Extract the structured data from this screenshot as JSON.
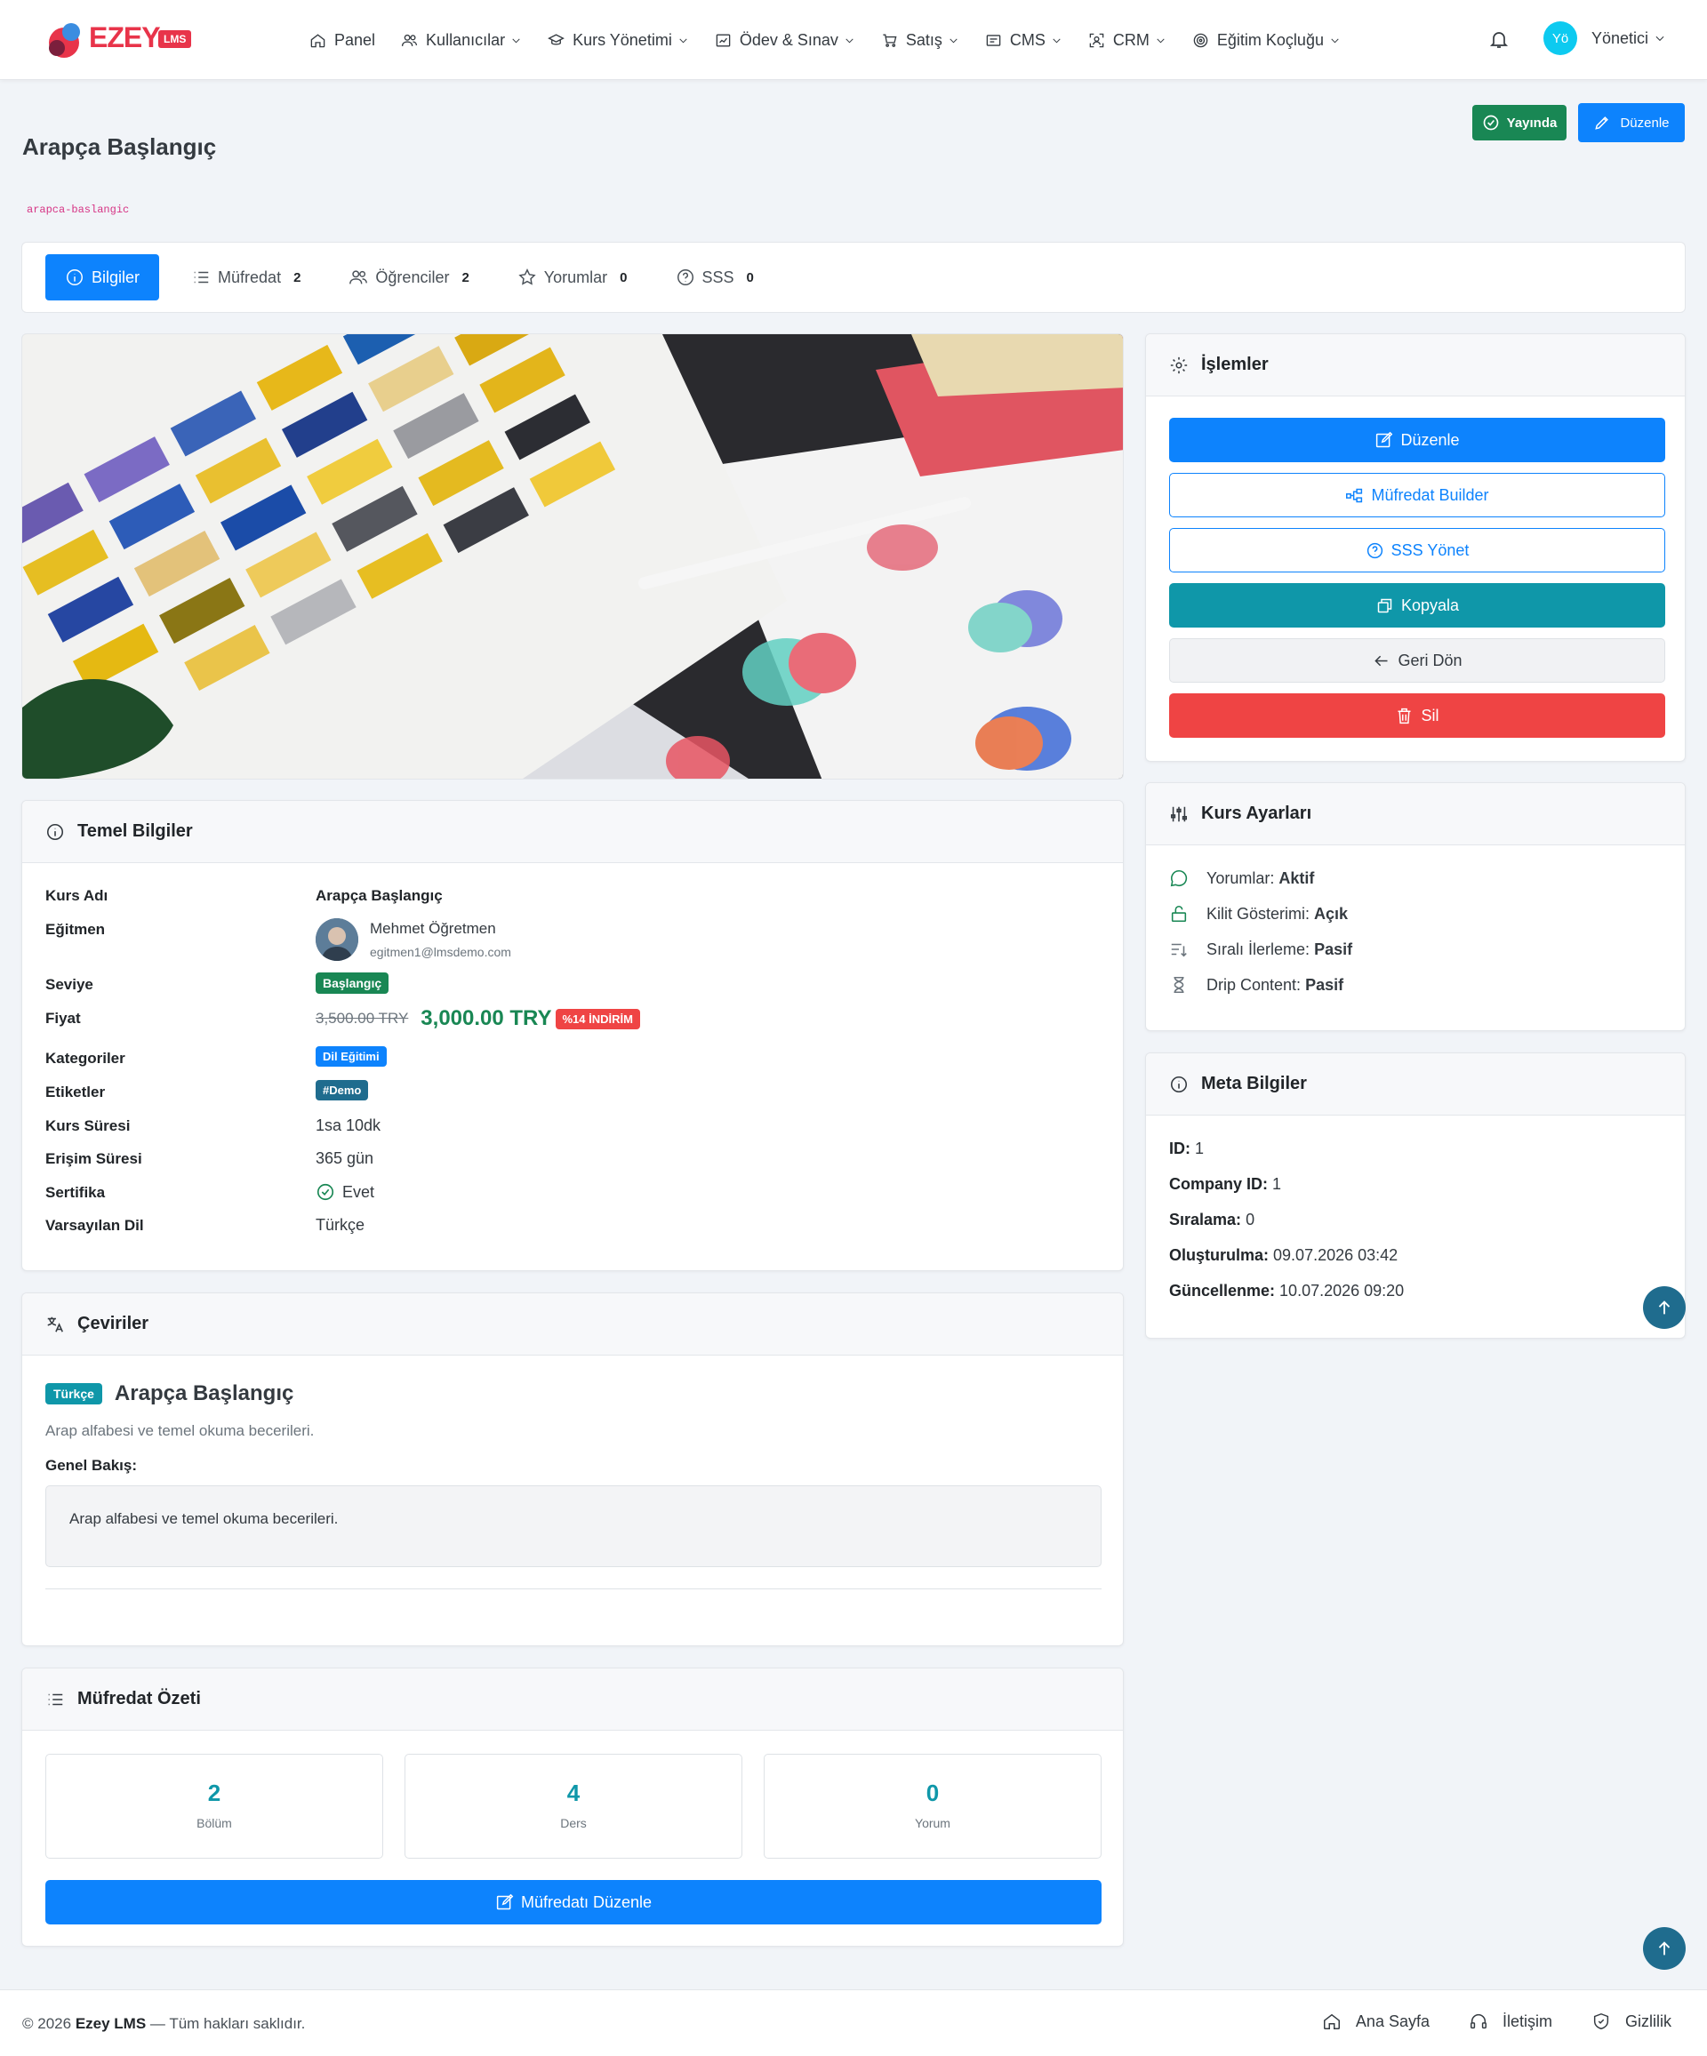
{
  "brand": {
    "name": "EZEY",
    "badge": "LMS"
  },
  "nav": {
    "items": [
      {
        "label": "Panel",
        "icon": "home-icon"
      },
      {
        "label": "Kullanıcılar",
        "icon": "users-icon"
      },
      {
        "label": "Kurs Yönetimi",
        "icon": "graduation-cap-icon"
      },
      {
        "label": "Ödev & Sınav",
        "icon": "clipboard-chart-icon"
      },
      {
        "label": "Satış",
        "icon": "cart-icon"
      },
      {
        "label": "CMS",
        "icon": "cms-icon"
      },
      {
        "label": "CRM",
        "icon": "crm-icon"
      },
      {
        "label": "Eğitim Koçluğu",
        "icon": "target-icon"
      }
    ],
    "user": {
      "initials": "Yö",
      "name": "Yönetici"
    }
  },
  "header": {
    "status_label": "Yayında",
    "edit_label": "Düzenle",
    "title": "Arapça Başlangıç",
    "slug": "arapca-baslangic"
  },
  "tabs": [
    {
      "label": "Bilgiler",
      "count": ""
    },
    {
      "label": "Müfredat",
      "count": "2"
    },
    {
      "label": "Öğrenciler",
      "count": "2"
    },
    {
      "label": "Yorumlar",
      "count": "0"
    },
    {
      "label": "SSS",
      "count": "0"
    }
  ],
  "basic_info": {
    "title": "Temel Bilgiler",
    "labels": {
      "name": "Kurs Adı",
      "instructor": "Eğitmen",
      "level": "Seviye",
      "price": "Fiyat",
      "categories": "Kategoriler",
      "tags": "Etiketler",
      "duration": "Kurs Süresi",
      "access": "Erişim Süresi",
      "certificate": "Sertifika",
      "language": "Varsayılan Dil"
    },
    "values": {
      "name": "Arapça Başlangıç",
      "instructor_name": "Mehmet Öğretmen",
      "instructor_email": "egitmen1@lmsdemo.com",
      "level": "Başlangıç",
      "old_price": "3,500.00 TRY",
      "price": "3,000.00 TRY",
      "discount": "%14 İNDİRİM",
      "category": "Dil Eğitimi",
      "tag": "#Demo",
      "duration": "1sa 10dk",
      "access": "365 gün",
      "certificate": "Evet",
      "language": "Türkçe"
    }
  },
  "translations": {
    "title": "Çeviriler",
    "lang_badge": "Türkçe",
    "course_title": "Arapça Başlangıç",
    "short_desc": "Arap alfabesi ve temel okuma becerileri.",
    "overview_label": "Genel Bakış:",
    "overview_text": "Arap alfabesi ve temel okuma becerileri."
  },
  "curriculum_summary": {
    "title": "Müfredat Özeti",
    "stats": [
      {
        "value": "2",
        "label": "Bölüm"
      },
      {
        "value": "4",
        "label": "Ders"
      },
      {
        "value": "0",
        "label": "Yorum"
      }
    ],
    "edit_button": "Müfredatı Düzenle"
  },
  "actions": {
    "title": "İşlemler",
    "edit": "Düzenle",
    "curriculum_builder": "Müfredat Builder",
    "faq_manage": "SSS Yönet",
    "copy": "Kopyala",
    "back": "Geri Dön",
    "delete": "Sil"
  },
  "course_settings": {
    "title": "Kurs Ayarları",
    "rows": [
      {
        "label": "Yorumlar:",
        "value": "Aktif"
      },
      {
        "label": "Kilit Gösterimi:",
        "value": "Açık"
      },
      {
        "label": "Sıralı İlerleme:",
        "value": "Pasif"
      },
      {
        "label": "Drip Content:",
        "value": "Pasif"
      }
    ]
  },
  "meta": {
    "title": "Meta Bilgiler",
    "rows": [
      {
        "label": "ID:",
        "value": "1"
      },
      {
        "label": "Company ID:",
        "value": "1"
      },
      {
        "label": "Sıralama:",
        "value": "0"
      },
      {
        "label": "Oluşturulma:",
        "value": "09.07.2026 03:42"
      },
      {
        "label": "Güncellenme:",
        "value": "10.07.2026 09:20"
      }
    ]
  },
  "footer": {
    "copy_prefix": "© 2026",
    "brand": "Ezey LMS",
    "copy_suffix": "— Tüm hakları saklıdır.",
    "links": [
      "Ana Sayfa",
      "İletişim",
      "Gizlilik"
    ]
  },
  "colors": {
    "primary": "#0d83fd",
    "success": "#198754",
    "danger": "#ef4444",
    "teal": "#0f97a9",
    "brand": "#e8344a"
  }
}
